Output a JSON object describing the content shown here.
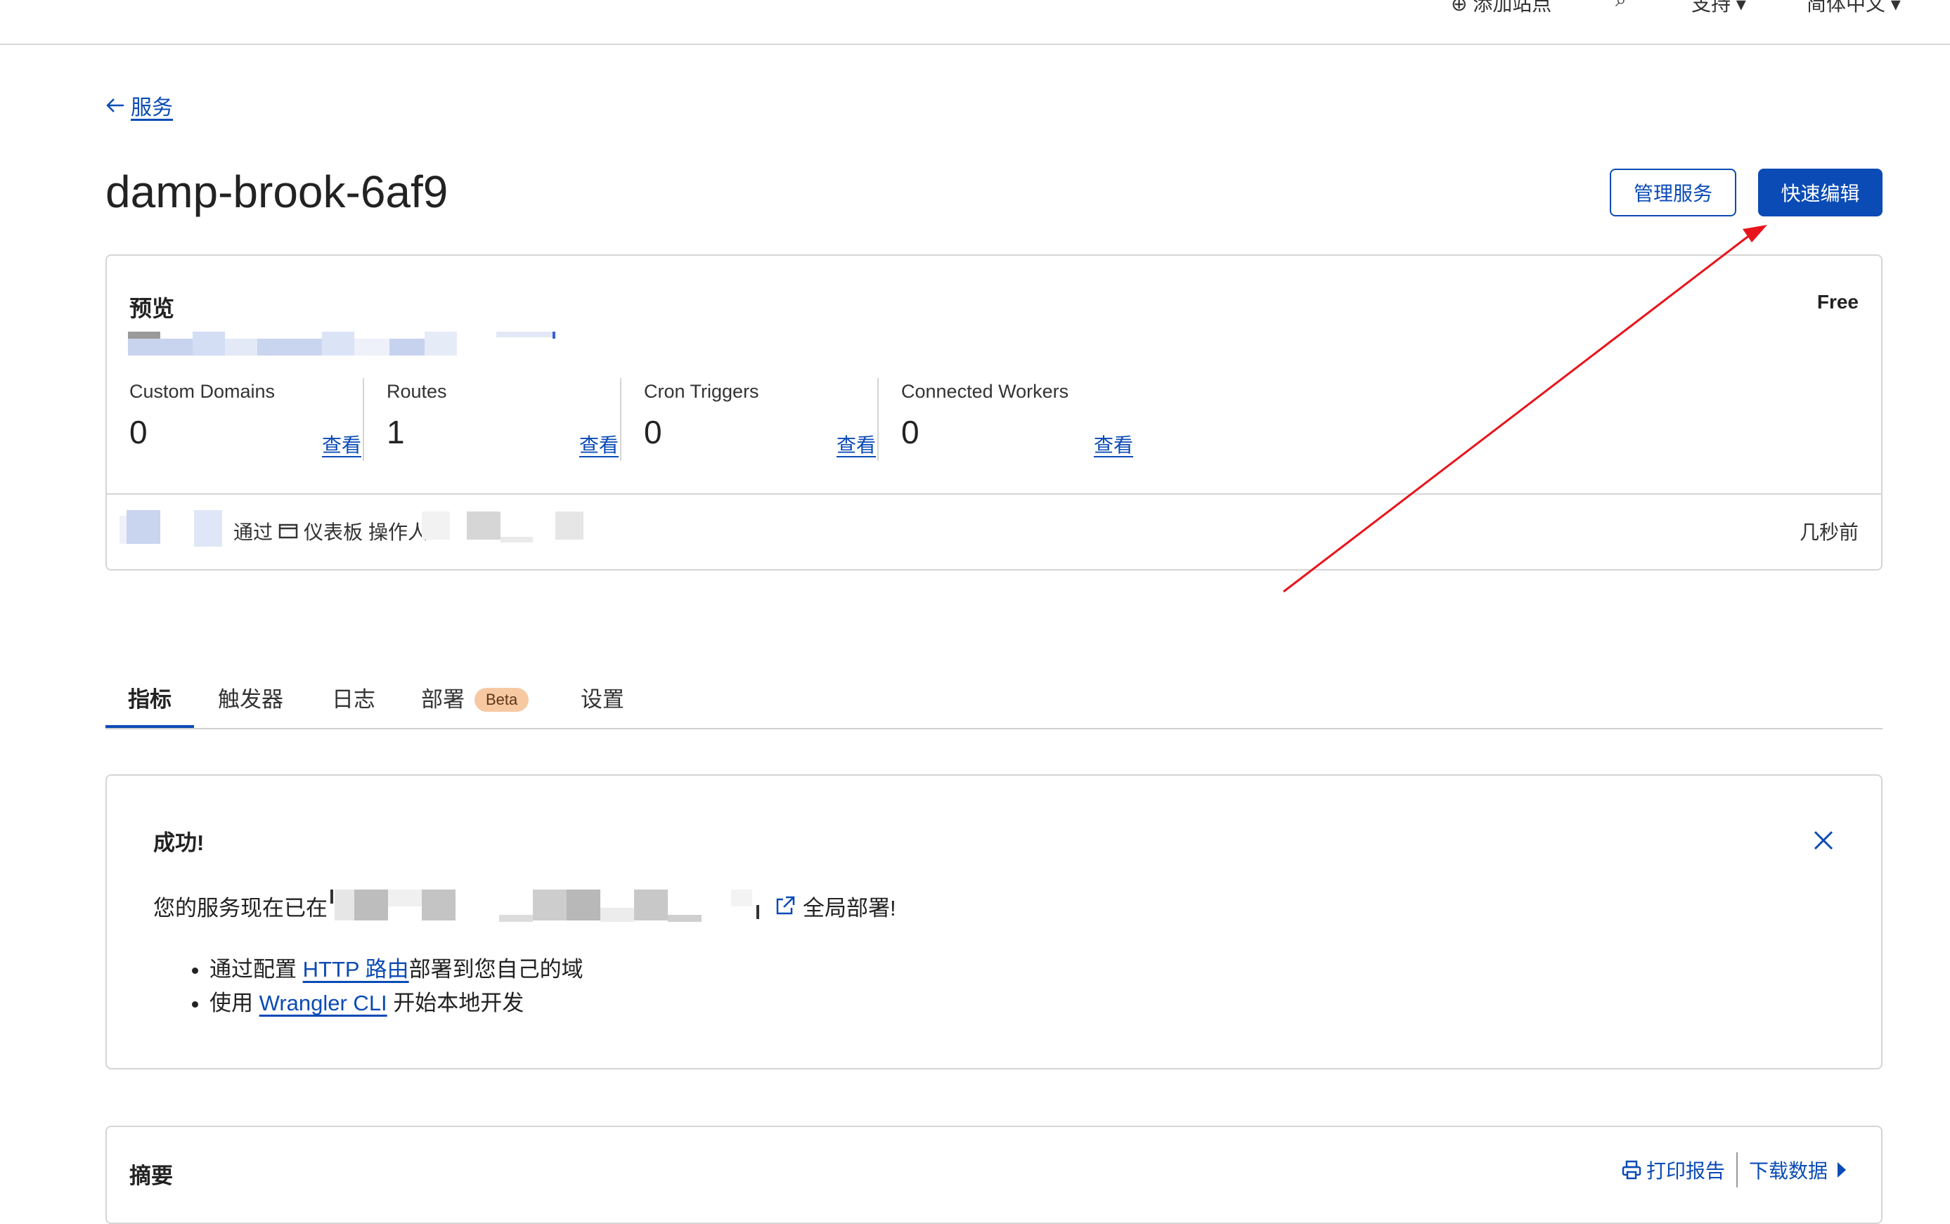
{
  "topbar": {
    "add_site": "添加站点",
    "support": "支持",
    "language": "简体中文"
  },
  "nav": {
    "back_label": "服务"
  },
  "worker": {
    "name": "damp-brook-6af9",
    "manage_label": "管理服务",
    "quick_edit_label": "快速编辑"
  },
  "overview": {
    "heading": "预览",
    "plan": "Free",
    "stats": [
      {
        "label": "Custom Domains",
        "count": "0",
        "link": "查看"
      },
      {
        "label": "Routes",
        "count": "1",
        "link": "查看"
      },
      {
        "label": "Cron Triggers",
        "count": "0",
        "link": "查看"
      },
      {
        "label": "Connected Workers",
        "count": "0",
        "link": "查看"
      }
    ],
    "deploy_via": "通过",
    "deploy_source": "仪表板",
    "deploy_by": "操作人",
    "deploy_time": "几秒前"
  },
  "tabs": [
    {
      "label": "指标"
    },
    {
      "label": "触发器"
    },
    {
      "label": "日志"
    },
    {
      "label": "部署",
      "badge": "Beta"
    },
    {
      "label": "设置"
    }
  ],
  "success": {
    "title": "成功!",
    "message_prefix": "您的服务现在已在",
    "message_suffix": "全局部署!",
    "bullet1_prefix": "通过配置",
    "bullet1_link": "HTTP 路由",
    "bullet1_suffix": "部署到您自己的域",
    "bullet2_prefix": "使用",
    "bullet2_link": "Wrangler CLI",
    "bullet2_suffix": "开始本地开发"
  },
  "summary": {
    "title": "摘要",
    "print_label": "打印报告",
    "download_label": "下载数据"
  },
  "colors": {
    "accent": "#0b4bb5",
    "annotation_arrow": "#e8141b",
    "beta_badge": "#f7c9a3"
  }
}
